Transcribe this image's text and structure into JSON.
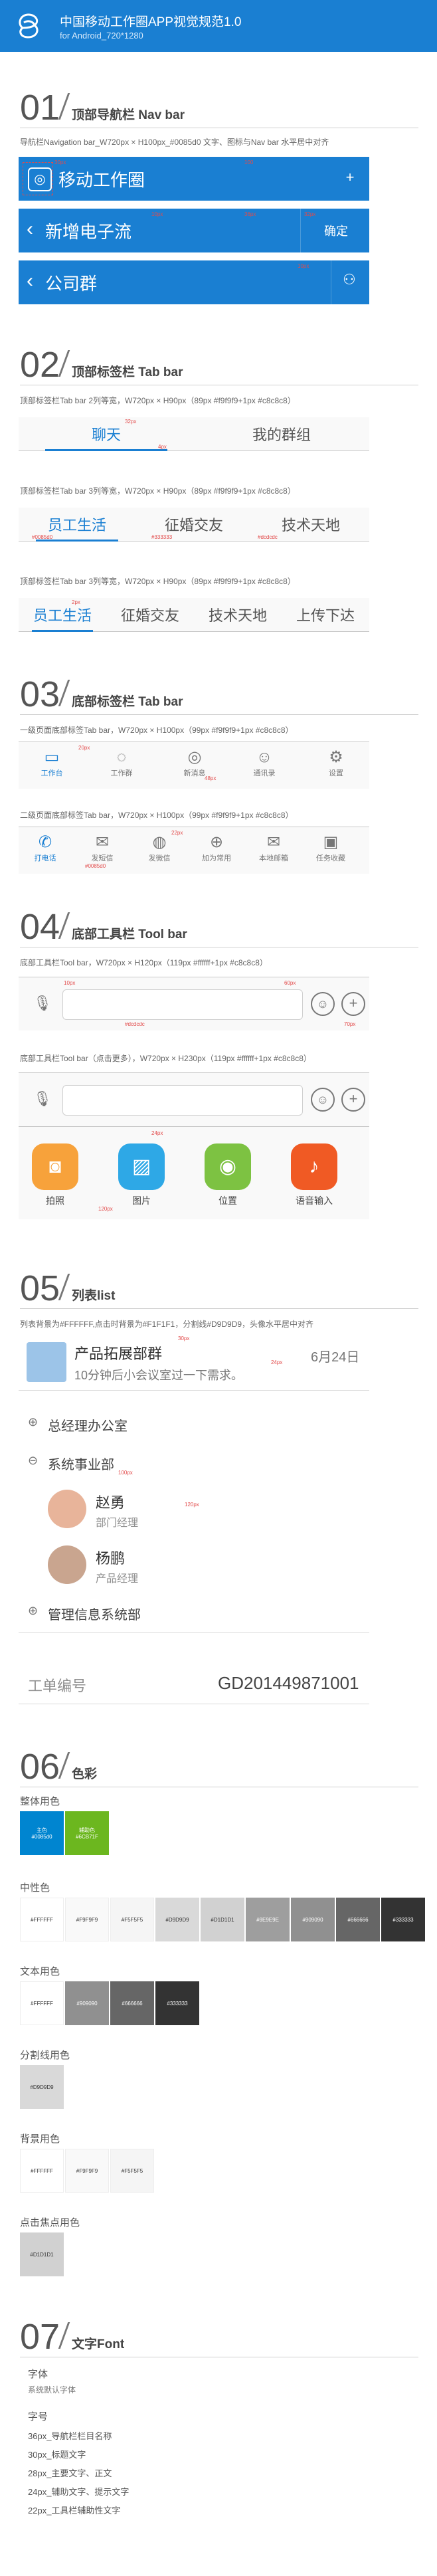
{
  "header": {
    "title": "中国移动工作圈APP视觉规范1.0",
    "subtitle": "for Android_720*1280"
  },
  "sec1": {
    "num": "01",
    "title": "顶部导航栏 Nav bar",
    "desc": "导航栏Navigation bar_W720px × H100px_#0085d0 文字、图标与Nav bar 水平居中对齐",
    "bar1_title": "移动工作圈",
    "bar2_title": "新增电子流",
    "bar2_right": "确定",
    "bar3_title": "公司群",
    "m_30px": "30px",
    "m_100": "100",
    "m_10px": "10px",
    "m_36px": "36px",
    "m_32px": "32px",
    "m_10px_b": "10px"
  },
  "sec2": {
    "num": "02",
    "title": "顶部标签栏 Tab bar",
    "desc1": "顶部标签栏Tab bar 2列等宽，W720px × H90px（89px #f9f9f9+1px #c8c8c8）",
    "desc2": "顶部标签栏Tab bar 3列等宽，W720px × H90px（89px #f9f9f9+1px #c8c8c8）",
    "desc3": "顶部标签栏Tab bar 3列等宽，W720px × H90px（89px #f9f9f9+1px #c8c8c8）",
    "tabs_a": [
      "聊天",
      "我的群组"
    ],
    "tabs_b": [
      "员工生活",
      "征婚交友",
      "技术天地"
    ],
    "tabs_c": [
      "员工生活",
      "征婚交友",
      "技术天地",
      "上传下达"
    ],
    "m_4px": "4px",
    "m_32px": "32px",
    "m_color_1": "#0085d0",
    "m_color_2": "#333333",
    "m_color_3": "#dcdcdc",
    "m_2px": "2px"
  },
  "sec3": {
    "num": "03",
    "title": "底部标签栏 Tab bar",
    "desc1": "一级页面底部标签Tab bar，W720px × H100px（99px #f9f9f9+1px #c8c8c8）",
    "desc2": "二级页面底部标签Tab bar，W720px × H100px（99px #f9f9f9+1px #c8c8c8）",
    "row1": [
      {
        "label": "工作台",
        "icon": "laptop-icon"
      },
      {
        "label": "工作群",
        "icon": "chat-bubble-icon"
      },
      {
        "label": "新消息",
        "icon": "lifebuoy-icon"
      },
      {
        "label": "通讯录",
        "icon": "contacts-icon"
      },
      {
        "label": "设置",
        "icon": "gear-icon"
      }
    ],
    "row2": [
      {
        "label": "打电话",
        "icon": "phone-icon"
      },
      {
        "label": "发短信",
        "icon": "sms-icon"
      },
      {
        "label": "发微信",
        "icon": "wechat-icon"
      },
      {
        "label": "加为常用",
        "icon": "add-user-icon"
      },
      {
        "label": "本地邮箱",
        "icon": "mail-icon"
      },
      {
        "label": "任务收藏",
        "icon": "archive-icon"
      }
    ],
    "m_20px": "20px",
    "m_48px": "48px",
    "m_22px": "22px",
    "m_color": "#0085d0"
  },
  "sec4": {
    "num": "04",
    "title": "底部工具栏 Tool bar",
    "desc1": "底部工具栏Tool bar，W720px × H120px（119px #ffffff+1px #c8c8c8）",
    "desc2": "底部工具栏Tool bar（点击更多），W720px × H230px（119px #ffffff+1px #c8c8c8）",
    "m_10px": "10px",
    "m_60px": "60px",
    "m_70px": "70px",
    "m_color": "#dcdcdc",
    "buttons": [
      {
        "label": "拍照",
        "icon": "camera-icon",
        "color": "#f7a23b"
      },
      {
        "label": "图片",
        "icon": "image-icon",
        "color": "#2ea8e6"
      },
      {
        "label": "位置",
        "icon": "location-icon",
        "color": "#7dc242"
      },
      {
        "label": "语音输入",
        "icon": "microphone-icon",
        "color": "#f05a24"
      }
    ],
    "m_120px": "120px",
    "m_24px": "24px"
  },
  "sec5": {
    "num": "05",
    "title": "列表list",
    "desc": "列表背景为#FFFFFF,点击时背景为#F1F1F1，分割线#D9D9D9，头像水平居中对齐",
    "item1_title": "产品拓展部群",
    "item1_sub": "10分钟后小会议室过一下需求。",
    "item1_date": "6月24日",
    "group1": "总经理办公室",
    "group2": "系统事业部",
    "person1_name": "赵勇",
    "person1_role": "部门经理",
    "person2_name": "杨鹏",
    "person2_role": "产品经理",
    "group3": "管理信息系统部",
    "field_label": "工单编号",
    "field_value": "GD201449871001",
    "m_30px": "30px",
    "m_24px": "24px",
    "m_100px": "100px",
    "m_120px": "120px"
  },
  "sec6": {
    "num": "06",
    "title": "色彩",
    "whole_title": "整体用色",
    "whole": [
      {
        "name": "主色",
        "hex": "#0085d0",
        "color": "#0085d0",
        "fg": "#ffffff"
      },
      {
        "name": "辅助色",
        "hex": "#6CB71F",
        "color": "#6cb71f",
        "fg": "#ffffff"
      }
    ],
    "neutral_title": "中性色",
    "neutral": [
      {
        "hex": "#FFFFFF",
        "color": "#ffffff",
        "fg": "#333333"
      },
      {
        "hex": "#F9F9F9",
        "color": "#f9f9f9",
        "fg": "#333333"
      },
      {
        "hex": "#F5F5F5",
        "color": "#f5f5f5",
        "fg": "#333333"
      },
      {
        "hex": "#D9D9D9",
        "color": "#d9d9d9",
        "fg": "#333333"
      },
      {
        "hex": "#D1D1D1",
        "color": "#d1d1d1",
        "fg": "#333333"
      },
      {
        "hex": "#9E9E9E",
        "color": "#9e9e9e",
        "fg": "#ffffff"
      },
      {
        "hex": "#909090",
        "color": "#909090",
        "fg": "#ffffff"
      },
      {
        "hex": "#666666",
        "color": "#666666",
        "fg": "#ffffff"
      },
      {
        "hex": "#333333",
        "color": "#333333",
        "fg": "#ffffff"
      }
    ],
    "text_title": "文本用色",
    "text": [
      {
        "hex": "#FFFFFF",
        "color": "#ffffff",
        "fg": "#333333"
      },
      {
        "hex": "#909090",
        "color": "#909090",
        "fg": "#ffffff"
      },
      {
        "hex": "#666666",
        "color": "#666666",
        "fg": "#ffffff"
      },
      {
        "hex": "#333333",
        "color": "#333333",
        "fg": "#ffffff"
      }
    ],
    "divider_title": "分割线用色",
    "divider": [
      {
        "hex": "#D9D9D9",
        "color": "#d9d9d9",
        "fg": "#333333"
      }
    ],
    "bg_title": "背景用色",
    "bg": [
      {
        "hex": "#FFFFFF",
        "color": "#ffffff",
        "fg": "#333333"
      },
      {
        "hex": "#F9F9F9",
        "color": "#f9f9f9",
        "fg": "#333333"
      },
      {
        "hex": "#F5F5F5",
        "color": "#f5f5f5",
        "fg": "#333333"
      }
    ],
    "focus_title": "点击焦点用色",
    "focus": [
      {
        "hex": "#D1D1D1",
        "color": "#d1d1d1",
        "fg": "#333333"
      }
    ]
  },
  "sec7": {
    "num": "07",
    "title": "文字Font",
    "font_label": "字体",
    "font_value": "系统默认字体",
    "size_label": "字号",
    "sizes": [
      "36px_导航栏栏目名称",
      "30px_标题文字",
      "28px_主要文字、正文",
      "24px_辅助文字、提示文字",
      "22px_工具栏辅助性文字"
    ]
  }
}
